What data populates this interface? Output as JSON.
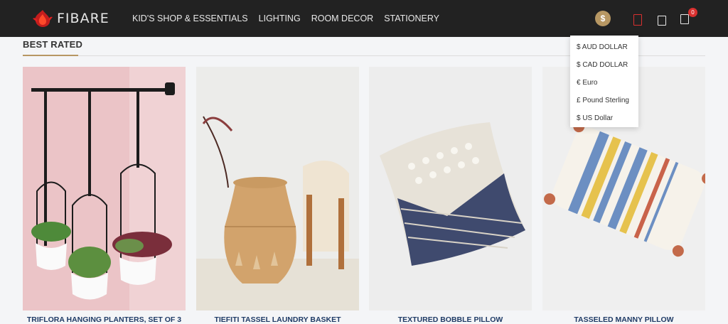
{
  "brand": {
    "name": "FIBARE"
  },
  "nav": {
    "items": [
      {
        "label": "KID'S SHOP & ESSENTIALS"
      },
      {
        "label": "LIGHTING"
      },
      {
        "label": "ROOM DECOR"
      },
      {
        "label": "STATIONERY"
      }
    ]
  },
  "header": {
    "currency_symbol": "$",
    "cart_count": "0"
  },
  "currency_menu": {
    "items": [
      {
        "label": "$ AUD DOLLAR"
      },
      {
        "label": "$ CAD DOLLAR"
      },
      {
        "label": "€ Euro"
      },
      {
        "label": "£ Pound Sterling"
      },
      {
        "label": "$ US Dollar"
      }
    ]
  },
  "section": {
    "title": "BEST RATED"
  },
  "products": [
    {
      "title": "TRIFLORA HANGING PLANTERS, SET OF 3"
    },
    {
      "title": "TIEFITI TASSEL LAUNDRY BASKET"
    },
    {
      "title": "TEXTURED BOBBLE PILLOW"
    },
    {
      "title": "TASSELED MANNY PILLOW"
    }
  ],
  "colors": {
    "topbar": "#222222",
    "accent_gold": "#b79763",
    "accent_red": "#d9302f",
    "product_title": "#1f3b66"
  },
  "icons": [
    "flame-logo-icon",
    "dollar-icon",
    "user-icon",
    "wishlist-icon",
    "cart-icon"
  ]
}
